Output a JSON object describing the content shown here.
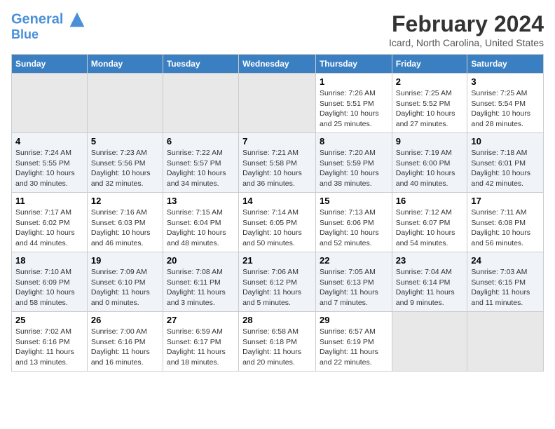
{
  "logo": {
    "line1": "General",
    "line2": "Blue"
  },
  "title": "February 2024",
  "subtitle": "Icard, North Carolina, United States",
  "days_of_week": [
    "Sunday",
    "Monday",
    "Tuesday",
    "Wednesday",
    "Thursday",
    "Friday",
    "Saturday"
  ],
  "weeks": [
    [
      {
        "num": "",
        "sunrise": "",
        "sunset": "",
        "daylight": "",
        "empty": true
      },
      {
        "num": "",
        "sunrise": "",
        "sunset": "",
        "daylight": "",
        "empty": true
      },
      {
        "num": "",
        "sunrise": "",
        "sunset": "",
        "daylight": "",
        "empty": true
      },
      {
        "num": "",
        "sunrise": "",
        "sunset": "",
        "daylight": "",
        "empty": true
      },
      {
        "num": "1",
        "sunrise": "Sunrise: 7:26 AM",
        "sunset": "Sunset: 5:51 PM",
        "daylight": "Daylight: 10 hours and 25 minutes."
      },
      {
        "num": "2",
        "sunrise": "Sunrise: 7:25 AM",
        "sunset": "Sunset: 5:52 PM",
        "daylight": "Daylight: 10 hours and 27 minutes."
      },
      {
        "num": "3",
        "sunrise": "Sunrise: 7:25 AM",
        "sunset": "Sunset: 5:54 PM",
        "daylight": "Daylight: 10 hours and 28 minutes."
      }
    ],
    [
      {
        "num": "4",
        "sunrise": "Sunrise: 7:24 AM",
        "sunset": "Sunset: 5:55 PM",
        "daylight": "Daylight: 10 hours and 30 minutes."
      },
      {
        "num": "5",
        "sunrise": "Sunrise: 7:23 AM",
        "sunset": "Sunset: 5:56 PM",
        "daylight": "Daylight: 10 hours and 32 minutes."
      },
      {
        "num": "6",
        "sunrise": "Sunrise: 7:22 AM",
        "sunset": "Sunset: 5:57 PM",
        "daylight": "Daylight: 10 hours and 34 minutes."
      },
      {
        "num": "7",
        "sunrise": "Sunrise: 7:21 AM",
        "sunset": "Sunset: 5:58 PM",
        "daylight": "Daylight: 10 hours and 36 minutes."
      },
      {
        "num": "8",
        "sunrise": "Sunrise: 7:20 AM",
        "sunset": "Sunset: 5:59 PM",
        "daylight": "Daylight: 10 hours and 38 minutes."
      },
      {
        "num": "9",
        "sunrise": "Sunrise: 7:19 AM",
        "sunset": "Sunset: 6:00 PM",
        "daylight": "Daylight: 10 hours and 40 minutes."
      },
      {
        "num": "10",
        "sunrise": "Sunrise: 7:18 AM",
        "sunset": "Sunset: 6:01 PM",
        "daylight": "Daylight: 10 hours and 42 minutes."
      }
    ],
    [
      {
        "num": "11",
        "sunrise": "Sunrise: 7:17 AM",
        "sunset": "Sunset: 6:02 PM",
        "daylight": "Daylight: 10 hours and 44 minutes."
      },
      {
        "num": "12",
        "sunrise": "Sunrise: 7:16 AM",
        "sunset": "Sunset: 6:03 PM",
        "daylight": "Daylight: 10 hours and 46 minutes."
      },
      {
        "num": "13",
        "sunrise": "Sunrise: 7:15 AM",
        "sunset": "Sunset: 6:04 PM",
        "daylight": "Daylight: 10 hours and 48 minutes."
      },
      {
        "num": "14",
        "sunrise": "Sunrise: 7:14 AM",
        "sunset": "Sunset: 6:05 PM",
        "daylight": "Daylight: 10 hours and 50 minutes."
      },
      {
        "num": "15",
        "sunrise": "Sunrise: 7:13 AM",
        "sunset": "Sunset: 6:06 PM",
        "daylight": "Daylight: 10 hours and 52 minutes."
      },
      {
        "num": "16",
        "sunrise": "Sunrise: 7:12 AM",
        "sunset": "Sunset: 6:07 PM",
        "daylight": "Daylight: 10 hours and 54 minutes."
      },
      {
        "num": "17",
        "sunrise": "Sunrise: 7:11 AM",
        "sunset": "Sunset: 6:08 PM",
        "daylight": "Daylight: 10 hours and 56 minutes."
      }
    ],
    [
      {
        "num": "18",
        "sunrise": "Sunrise: 7:10 AM",
        "sunset": "Sunset: 6:09 PM",
        "daylight": "Daylight: 10 hours and 58 minutes."
      },
      {
        "num": "19",
        "sunrise": "Sunrise: 7:09 AM",
        "sunset": "Sunset: 6:10 PM",
        "daylight": "Daylight: 11 hours and 0 minutes."
      },
      {
        "num": "20",
        "sunrise": "Sunrise: 7:08 AM",
        "sunset": "Sunset: 6:11 PM",
        "daylight": "Daylight: 11 hours and 3 minutes."
      },
      {
        "num": "21",
        "sunrise": "Sunrise: 7:06 AM",
        "sunset": "Sunset: 6:12 PM",
        "daylight": "Daylight: 11 hours and 5 minutes."
      },
      {
        "num": "22",
        "sunrise": "Sunrise: 7:05 AM",
        "sunset": "Sunset: 6:13 PM",
        "daylight": "Daylight: 11 hours and 7 minutes."
      },
      {
        "num": "23",
        "sunrise": "Sunrise: 7:04 AM",
        "sunset": "Sunset: 6:14 PM",
        "daylight": "Daylight: 11 hours and 9 minutes."
      },
      {
        "num": "24",
        "sunrise": "Sunrise: 7:03 AM",
        "sunset": "Sunset: 6:15 PM",
        "daylight": "Daylight: 11 hours and 11 minutes."
      }
    ],
    [
      {
        "num": "25",
        "sunrise": "Sunrise: 7:02 AM",
        "sunset": "Sunset: 6:16 PM",
        "daylight": "Daylight: 11 hours and 13 minutes."
      },
      {
        "num": "26",
        "sunrise": "Sunrise: 7:00 AM",
        "sunset": "Sunset: 6:16 PM",
        "daylight": "Daylight: 11 hours and 16 minutes."
      },
      {
        "num": "27",
        "sunrise": "Sunrise: 6:59 AM",
        "sunset": "Sunset: 6:17 PM",
        "daylight": "Daylight: 11 hours and 18 minutes."
      },
      {
        "num": "28",
        "sunrise": "Sunrise: 6:58 AM",
        "sunset": "Sunset: 6:18 PM",
        "daylight": "Daylight: 11 hours and 20 minutes."
      },
      {
        "num": "29",
        "sunrise": "Sunrise: 6:57 AM",
        "sunset": "Sunset: 6:19 PM",
        "daylight": "Daylight: 11 hours and 22 minutes."
      },
      {
        "num": "",
        "sunrise": "",
        "sunset": "",
        "daylight": "",
        "empty": true
      },
      {
        "num": "",
        "sunrise": "",
        "sunset": "",
        "daylight": "",
        "empty": true
      }
    ]
  ]
}
